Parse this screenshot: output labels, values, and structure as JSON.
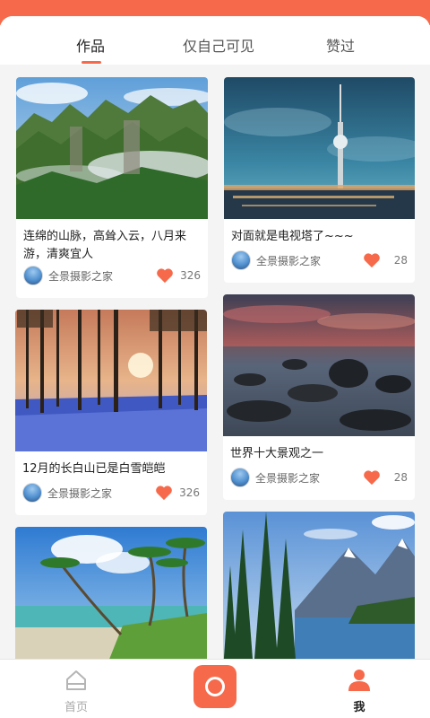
{
  "tabs": [
    {
      "label": "作品"
    },
    {
      "label": "仅自己可见"
    },
    {
      "label": "赞过"
    }
  ],
  "colors": {
    "accent": "#f66a4b"
  },
  "cards": [
    {
      "title": "连绵的山脉，高耸入云，八月来游，清爽宜人",
      "author": "全景摄影之家",
      "likes": "326"
    },
    {
      "title": "对面就是电视塔了~~~",
      "author": "全景摄影之家",
      "likes": "28"
    },
    {
      "title": "12月的长白山已是白雪皑皑",
      "author": "全景摄影之家",
      "likes": "326"
    },
    {
      "title": "世界十大景观之一",
      "author": "全景摄影之家",
      "likes": "28"
    },
    {
      "title": "",
      "author": "",
      "likes": ""
    },
    {
      "title": "",
      "author": "",
      "likes": ""
    }
  ],
  "nav": {
    "home_label": "首页",
    "me_label": "我",
    "home_icon": "home-icon",
    "camera_icon": "camera-icon",
    "me_icon": "person-icon"
  }
}
